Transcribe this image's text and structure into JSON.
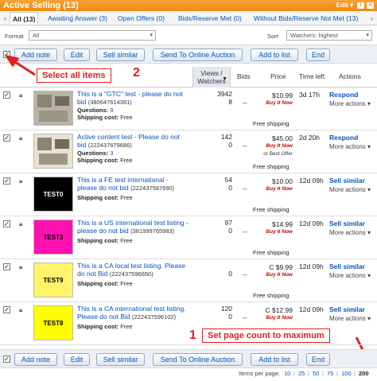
{
  "header": {
    "title": "Active Selling (13)",
    "edit_label": "Edit ▾"
  },
  "tabs": [
    {
      "label": "All (13)"
    },
    {
      "label": "Awaiting Answer (3)"
    },
    {
      "label": "Open Offers (0)"
    },
    {
      "label": "Bids/Reserve Met (0)"
    },
    {
      "label": "Without Bids/Reserve Not Met (13)"
    }
  ],
  "filter": {
    "format_label": "Format",
    "format_value": "All",
    "sort_label": "Sort",
    "sort_value": "Watchers: highest"
  },
  "toolbar": {
    "add_note": "Add note",
    "edit": "Edit",
    "sell_similar": "Sell similar",
    "send_auction": "Send To Online Auction",
    "add_to_list": "Add to list",
    "end": "End"
  },
  "columns": {
    "views_watchers": "Views / Watchers",
    "bids": "Bids",
    "price": "Price",
    "time_left": "Time left",
    "actions": "Actions"
  },
  "annotations": {
    "select_all": "Select all items",
    "select_all_num": "2",
    "page_count": "Set page count to maximum",
    "page_count_num": "1"
  },
  "rows": [
    {
      "title": "This is a \"GTC\" test - please do not bid",
      "id": "(380647614391)",
      "thumb": "",
      "thumb_color": "#b8b3a4",
      "questions_label": "Questions:",
      "questions_value": "9",
      "shipping_label": "Shipping cost:",
      "shipping_value": "Free",
      "views": "3942",
      "watchers": "8",
      "bids": "--",
      "price": "$10.99",
      "price_note": "Buy It Now",
      "free_shipping": "Free shipping",
      "time_left": "3d 17h",
      "action": "Respond",
      "more": "More actions ▾"
    },
    {
      "title": "Active content test - Please do not bid",
      "id": "(222437679686)",
      "thumb": "",
      "thumb_color": "#e8e2d0",
      "questions_label": "Questions:",
      "questions_value": "3",
      "shipping_label": "Shipping cost:",
      "shipping_value": "Free",
      "views": "142",
      "watchers": "0",
      "bids": "--",
      "price": "$45.00",
      "price_note": "Buy It Now",
      "price_note2": "or Best Offer",
      "free_shipping": "Free shipping",
      "time_left": "2d 20h",
      "action": "Respond",
      "more": "More actions ▾"
    },
    {
      "title": "This is a FE test international - please do not bid",
      "id": "(222437587690)",
      "thumb": "TEST0",
      "thumb_color": "#000000",
      "thumb_text_color": "#ffffff",
      "shipping_label": "Shipping cost:",
      "shipping_value": "Free",
      "views": "54",
      "watchers": "0",
      "bids": "--",
      "price": "$10.00",
      "price_note": "Buy It Now",
      "free_shipping": "Free shipping",
      "time_left": "12d 09h",
      "action": "Sell similar",
      "more": "More actions ▾"
    },
    {
      "title": "This is a US international test listing - please do not bid",
      "id": "(381999765983)",
      "thumb": "TEST3",
      "thumb_color": "#ff10b0",
      "thumb_text_color": "#000000",
      "shipping_label": "Shipping cost:",
      "shipping_value": "Free",
      "views": "97",
      "watchers": "0",
      "bids": "--",
      "price": "$14.99",
      "price_note": "Buy It Now",
      "free_shipping": "Free shipping",
      "time_left": "12d 09h",
      "action": "Sell similar",
      "more": "More actions ▾"
    },
    {
      "title": "This is a CA local test listing. Please do not Bid",
      "id": "(222437596650)",
      "thumb": "TEST9",
      "thumb_color": "#fff36a",
      "thumb_text_color": "#000000",
      "shipping_label": "Shipping cost:",
      "shipping_value": "Free",
      "views": "",
      "watchers": "0",
      "bids": "--",
      "price": "C $9.99",
      "price_note": "Buy It Now",
      "free_shipping": "Free shipping",
      "time_left": "12d 09h",
      "action": "Sell similar",
      "more": "More actions ▾"
    },
    {
      "title": "This is a CA international test listing. Please do not Bid",
      "id": "(222437596102)",
      "thumb": "TEST8",
      "thumb_color": "#ffff00",
      "thumb_text_color": "#000000",
      "shipping_label": "Shipping cost:",
      "shipping_value": "Free",
      "views": "120",
      "watchers": "0",
      "bids": "--",
      "price": "C $12.99",
      "price_note": "Buy It Now",
      "free_shipping": "",
      "time_left": "12d 09h",
      "action": "Sell similar",
      "more": "More actions ▾"
    }
  ],
  "pager": {
    "label": "Items per page:",
    "options": [
      "10",
      "25",
      "50",
      "75",
      "100",
      "200"
    ],
    "selected": "200"
  },
  "colors": {
    "accent": "#ee8a0c",
    "link": "#0654ba",
    "annotation": "#e02020"
  }
}
